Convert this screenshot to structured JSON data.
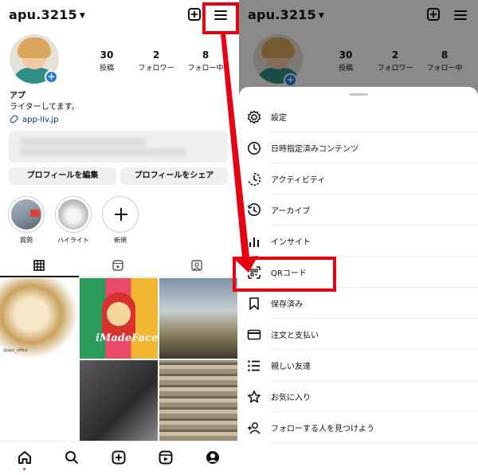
{
  "left": {
    "username": "apu.3215",
    "stats": [
      {
        "number": "30",
        "label": "投稿"
      },
      {
        "number": "2",
        "label": "フォロワー"
      },
      {
        "number": "8",
        "label": "フォロー中"
      }
    ],
    "profile_name": "アプ",
    "bio": "ライターしてます。",
    "link": "app-liv.jp",
    "buttons": {
      "edit": "プロフィールを編集",
      "share": "プロフィールをシェア"
    },
    "highlights": [
      {
        "label": "質問"
      },
      {
        "label": "ハイライト"
      },
      {
        "label": "新規"
      }
    ],
    "post_overlay_text": "iMadeFace",
    "post_tag": "@apu_office"
  },
  "right": {
    "username": "apu.3215",
    "stats": [
      {
        "number": "30",
        "label": "投稿"
      },
      {
        "number": "2",
        "label": "フォロワー"
      },
      {
        "number": "8",
        "label": "フォロー中"
      }
    ],
    "menu": [
      {
        "label": "設定",
        "icon": "settings-icon"
      },
      {
        "label": "日時指定済みコンテンツ",
        "icon": "clock-icon"
      },
      {
        "label": "アクティビティ",
        "icon": "activity-icon"
      },
      {
        "label": "アーカイブ",
        "icon": "archive-icon"
      },
      {
        "label": "インサイト",
        "icon": "insights-icon"
      },
      {
        "label": "QRコード",
        "icon": "qr-code-icon"
      },
      {
        "label": "保存済み",
        "icon": "bookmark-icon"
      },
      {
        "label": "注文と支払い",
        "icon": "card-icon"
      },
      {
        "label": "親しい友達",
        "icon": "close-friends-icon"
      },
      {
        "label": "お気に入り",
        "icon": "star-icon"
      },
      {
        "label": "フォローする人を見つけよう",
        "icon": "add-person-icon"
      }
    ]
  },
  "colors": {
    "annotation": "#e60012",
    "link": "#00376b",
    "accent": "#1877f2"
  }
}
